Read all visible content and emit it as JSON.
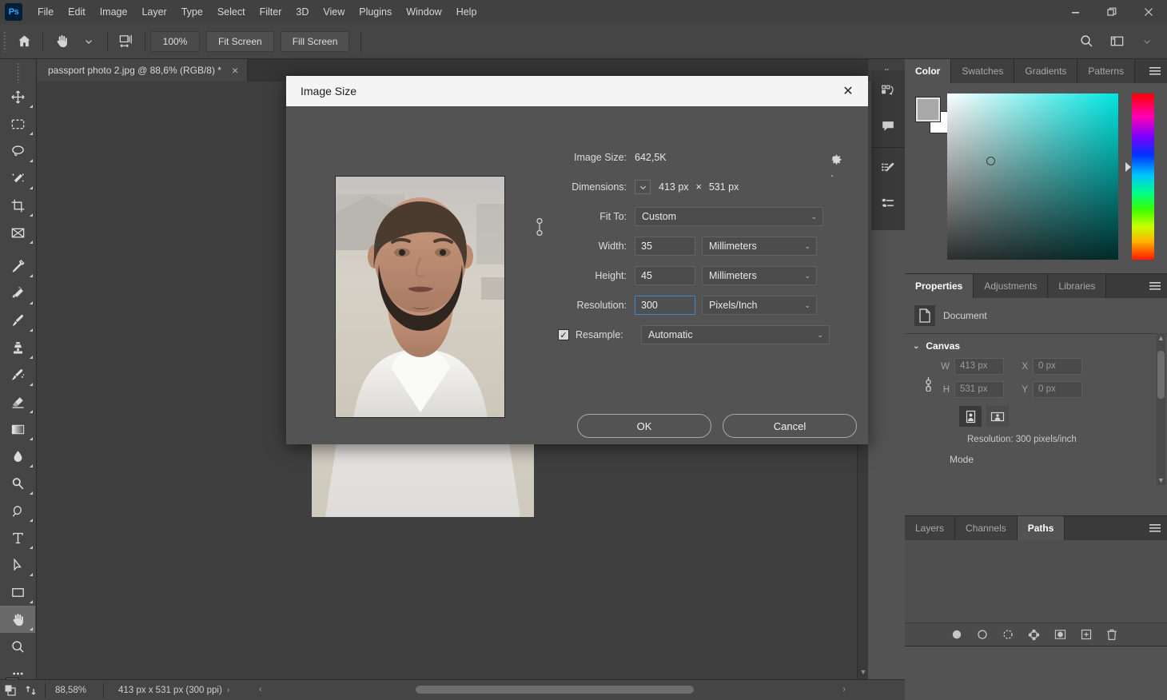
{
  "app": {
    "name": "Adobe Photoshop",
    "logo_text": "Ps"
  },
  "menubar": {
    "items": [
      "File",
      "Edit",
      "Image",
      "Layer",
      "Type",
      "Select",
      "Filter",
      "3D",
      "View",
      "Plugins",
      "Window",
      "Help"
    ]
  },
  "window_controls": {
    "minimize": "minimize-button",
    "restore": "restore-button",
    "close": "close-button"
  },
  "options_bar": {
    "home_icon": "home-icon",
    "tool_icon": "hand-tool-icon",
    "tool_preset_caret": "chevron-down-icon",
    "scroll_all_windows_icon": "scroll-all-windows-icon",
    "zoom_100_label": "100%",
    "fit_screen_label": "Fit Screen",
    "fill_screen_label": "Fill Screen",
    "search_icon": "search-icon",
    "workspace_icon": "workspace-switcher-icon"
  },
  "toolbar": {
    "tools": [
      {
        "name": "move-tool",
        "glyph": "move"
      },
      {
        "name": "rectangular-marquee-tool",
        "glyph": "marquee"
      },
      {
        "name": "lasso-tool",
        "glyph": "lasso"
      },
      {
        "name": "object-selection-tool",
        "glyph": "wand"
      },
      {
        "name": "crop-tool",
        "glyph": "crop"
      },
      {
        "name": "frame-tool",
        "glyph": "frame"
      },
      {
        "name": "eyedropper-tool",
        "glyph": "eyedropper"
      },
      {
        "name": "spot-healing-brush-tool",
        "glyph": "healing"
      },
      {
        "name": "brush-tool",
        "glyph": "brush"
      },
      {
        "name": "clone-stamp-tool",
        "glyph": "stamp"
      },
      {
        "name": "history-brush-tool",
        "glyph": "historybrush"
      },
      {
        "name": "eraser-tool",
        "glyph": "eraser"
      },
      {
        "name": "gradient-tool",
        "glyph": "gradient"
      },
      {
        "name": "blur-tool",
        "glyph": "blur"
      },
      {
        "name": "dodge-tool",
        "glyph": "dodge"
      },
      {
        "name": "pen-tool",
        "glyph": "pen"
      },
      {
        "name": "type-tool",
        "glyph": "type"
      },
      {
        "name": "path-selection-tool",
        "glyph": "pathselect"
      },
      {
        "name": "rectangle-tool",
        "glyph": "rectangle"
      },
      {
        "name": "hand-tool",
        "glyph": "hand",
        "active": true
      },
      {
        "name": "zoom-tool",
        "glyph": "zoom"
      },
      {
        "name": "edit-toolbar-button",
        "glyph": "ellipsis"
      }
    ],
    "foreground_color": "#a8a8a8",
    "background_color": "#ffffff"
  },
  "document_tab": {
    "title": "passport photo 2.jpg @ 88,6% (RGB/8) *",
    "close_glyph": "×"
  },
  "canvas": {
    "collapse_glyph": "«"
  },
  "icon_rail": {
    "items": [
      {
        "name": "history-panel-icon"
      },
      {
        "name": "comments-panel-icon"
      },
      {
        "name": "brush-settings-panel-icon"
      },
      {
        "name": "brush-presets-panel-icon"
      }
    ]
  },
  "color_panel": {
    "tabs": [
      {
        "label": "Color",
        "active": true
      },
      {
        "label": "Swatches",
        "active": false
      },
      {
        "label": "Gradients",
        "active": false
      },
      {
        "label": "Patterns",
        "active": false
      }
    ],
    "menu_icon": "panel-menu-icon",
    "foreground_swatch": "#a8a8a8",
    "background_swatch": "#ffffff",
    "field_hue": "#00e5e0"
  },
  "properties_panel": {
    "tabs": [
      {
        "label": "Properties",
        "active": true
      },
      {
        "label": "Adjustments",
        "active": false
      },
      {
        "label": "Libraries",
        "active": false
      }
    ],
    "menu_icon": "panel-menu-icon",
    "document_label": "Document",
    "document_icon": "document-icon",
    "canvas_section_label": "Canvas",
    "w_label": "W",
    "w_value": "413 px",
    "h_label": "H",
    "h_value": "531 px",
    "x_label": "X",
    "x_value": "0 px",
    "y_label": "Y",
    "y_value": "0 px",
    "link_icon": "link-aspect-ratio-icon",
    "orientation_portrait_icon": "portrait-orientation-icon",
    "orientation_landscape_icon": "landscape-orientation-icon",
    "resolution_line": "Resolution: 300 pixels/inch",
    "mode_label": "Mode"
  },
  "layers_panel": {
    "tabs": [
      {
        "label": "Layers",
        "active": false
      },
      {
        "label": "Channels",
        "active": false
      },
      {
        "label": "Paths",
        "active": true
      }
    ],
    "menu_icon": "panel-menu-icon",
    "footer_icons": [
      {
        "name": "fill-path-with-foreground-color-icon"
      },
      {
        "name": "stroke-path-with-brush-icon"
      },
      {
        "name": "load-path-as-selection-icon"
      },
      {
        "name": "make-work-path-from-selection-icon"
      },
      {
        "name": "add-layer-mask-icon"
      },
      {
        "name": "create-new-path-icon"
      },
      {
        "name": "delete-path-icon"
      }
    ]
  },
  "status_bar": {
    "doc_icon": "document-thumbnail-icon",
    "arrange_icon": "arrange-documents-icon",
    "zoom_level": "88,58%",
    "doc_size": "413 px x 531 px (300 ppi)",
    "expand_glyph": "›",
    "left_arrow_glyph": "‹",
    "right_arrow_glyph": "›"
  },
  "dialog": {
    "title": "Image Size",
    "close_glyph": "✕",
    "gear_icon": "settings-gear-icon",
    "image_size_label": "Image Size:",
    "image_size_value": "642,5K",
    "dimensions_label": "Dimensions:",
    "dimensions_width": "413 px",
    "dimensions_separator": "×",
    "dimensions_height": "531 px",
    "dimensions_caret": "chevron-down-icon",
    "fit_to_label": "Fit To:",
    "fit_to_value": "Custom",
    "width_label": "Width:",
    "width_value": "35",
    "width_unit": "Millimeters",
    "height_label": "Height:",
    "height_value": "45",
    "height_unit": "Millimeters",
    "resolution_label": "Resolution:",
    "resolution_value": "300",
    "resolution_unit": "Pixels/Inch",
    "chain_icon": "constrain-proportions-icon",
    "resample_label": "Resample:",
    "resample_checked": true,
    "resample_value": "Automatic",
    "ok_label": "OK",
    "cancel_label": "Cancel",
    "preview_alt": "passport-photo-preview"
  }
}
